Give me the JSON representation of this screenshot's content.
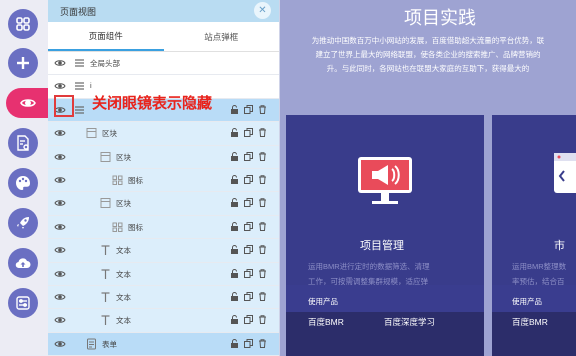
{
  "panel": {
    "title": "页面视图",
    "close_icon": "close-icon",
    "tabs": [
      {
        "label": "页面组件",
        "active": true
      },
      {
        "label": "站点弹框",
        "active": false
      }
    ],
    "rows": [
      {
        "label": "全局头部",
        "indent": 0,
        "type": "list-icon",
        "actions": false,
        "state": "normal"
      },
      {
        "label": "i",
        "indent": 0,
        "type": "list-icon",
        "actions": false,
        "state": "normal"
      },
      {
        "label": "",
        "indent": 0,
        "type": "list-icon",
        "actions": true,
        "state": "selected"
      },
      {
        "label": "区块",
        "indent": 1,
        "type": "block-icon",
        "actions": true,
        "state": "highlight"
      },
      {
        "label": "区块",
        "indent": 2,
        "type": "block-icon",
        "actions": true,
        "state": "highlight"
      },
      {
        "label": "图标",
        "indent": 3,
        "type": "grid-icon",
        "actions": true,
        "state": "highlight"
      },
      {
        "label": "区块",
        "indent": 2,
        "type": "block-icon",
        "actions": true,
        "state": "highlight"
      },
      {
        "label": "图标",
        "indent": 3,
        "type": "grid-icon",
        "actions": true,
        "state": "highlight"
      },
      {
        "label": "文本",
        "indent": 2,
        "type": "text-icon",
        "actions": true,
        "state": "highlight"
      },
      {
        "label": "文本",
        "indent": 2,
        "type": "text-icon",
        "actions": true,
        "state": "highlight"
      },
      {
        "label": "文本",
        "indent": 2,
        "type": "text-icon",
        "actions": true,
        "state": "highlight"
      },
      {
        "label": "文本",
        "indent": 2,
        "type": "text-icon",
        "actions": true,
        "state": "highlight"
      },
      {
        "label": "表单",
        "indent": 1,
        "type": "form-icon",
        "actions": true,
        "state": "selected"
      }
    ]
  },
  "annotation": "关闭眼镜表示隐藏",
  "rail": {
    "icons": [
      "grid-icon",
      "plus-icon",
      "eye-icon",
      "settings-doc-icon",
      "palette-icon",
      "rocket-icon",
      "cloud-upload-icon",
      "sliders-icon"
    ]
  },
  "page": {
    "title": "项目实践",
    "desc": [
      "为推动中国数百万中小网站的发展，百度借助超大流量的平台优势，联",
      "建立了世界上最大的网络联盟，使各类企业的搜索推广、品牌营销的",
      "升。与此同时，各网站也在联盟大家庭的互助下，获得最大的"
    ],
    "cards": [
      {
        "title": "项目管理",
        "desc": [
          "运用BMR进行定时的数据筛选、清理",
          "工作，可按需调整集群规模，适应弹"
        ],
        "foot_label": "使用产品",
        "products": [
          "百度BMR",
          "百度深度学习"
        ]
      },
      {
        "title": "市",
        "desc": [
          "运用BMR整理数",
          "率预估，结合百"
        ],
        "foot_label": "使用产品",
        "products": [
          "百度BMR"
        ]
      }
    ]
  },
  "colors": {
    "accent": "#e73170",
    "rail_btn": "#6a6fc2",
    "page_bg": "#9ea3d2",
    "card_bg": "#393c8b",
    "annotation": "#e8231c"
  }
}
